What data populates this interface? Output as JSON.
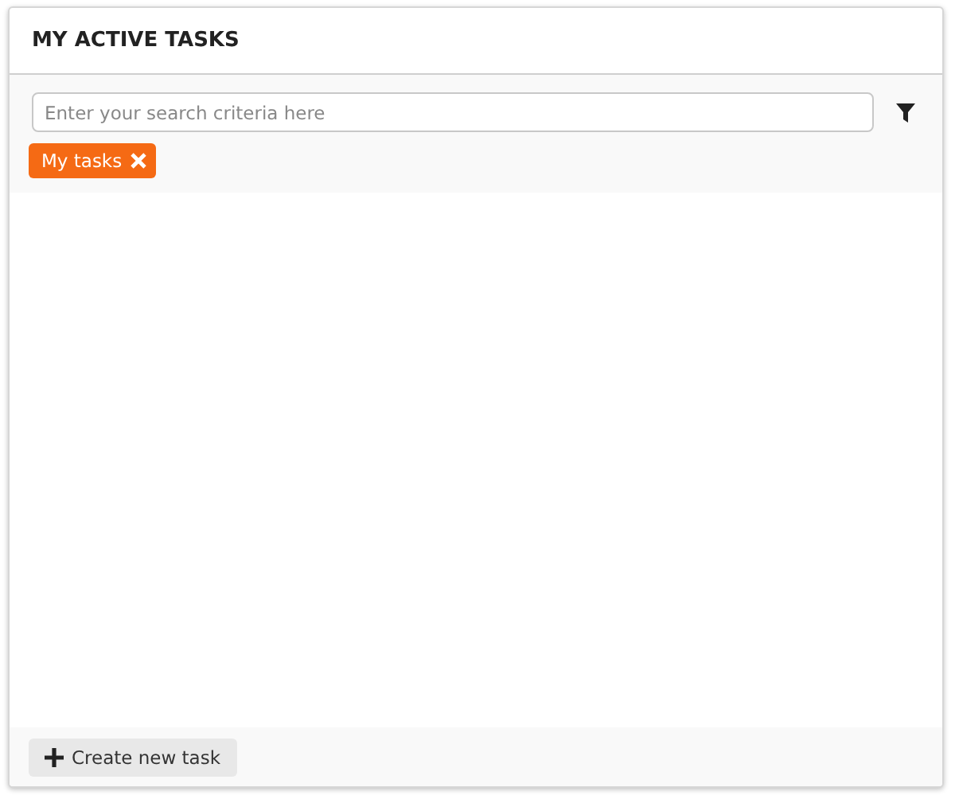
{
  "panel": {
    "title": "MY ACTIVE TASKS"
  },
  "search": {
    "placeholder": "Enter your search criteria here"
  },
  "filters": [
    {
      "label": "My tasks",
      "removable": true
    }
  ],
  "footer": {
    "button": "Create new task"
  }
}
